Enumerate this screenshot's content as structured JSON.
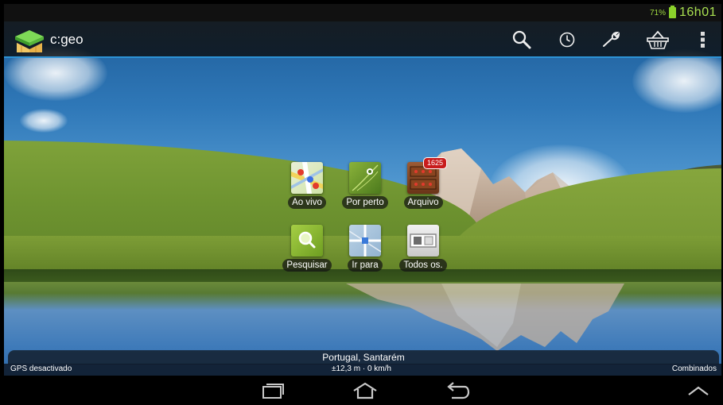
{
  "status_bar": {
    "battery_percent": "71%",
    "time": "16h01",
    "battery_color": "#8bd12b"
  },
  "action_bar": {
    "title": "c:geo",
    "accent_color": "#2d93d6",
    "actions": [
      {
        "name": "search",
        "icon": "search-icon"
      },
      {
        "name": "history",
        "icon": "clock-icon"
      },
      {
        "name": "settings",
        "icon": "wrench-icon"
      },
      {
        "name": "basket",
        "icon": "basket-icon"
      },
      {
        "name": "overflow",
        "icon": "overflow-menu-icon"
      }
    ]
  },
  "dashboard": {
    "buttons": [
      {
        "label": "Ao vivo",
        "icon": "map-icon"
      },
      {
        "label": "Por perto",
        "icon": "nearby-icon"
      },
      {
        "label": "Arquivo",
        "icon": "archive-icon",
        "badge": "1625"
      },
      {
        "label": "Pesquisar",
        "icon": "search-icon"
      },
      {
        "label": "Ir para",
        "icon": "goto-map-icon"
      },
      {
        "label": "Todos os.",
        "icon": "lists-icon"
      }
    ]
  },
  "location": {
    "place": "Portugal, Santarém",
    "gps_status": "GPS desactivado",
    "accuracy_speed": "±12,3 m · 0 km/h",
    "provider": "Combinados"
  },
  "navigation": {
    "buttons": [
      "recent-apps-icon",
      "home-icon",
      "back-icon",
      "chevron-up-icon"
    ]
  }
}
